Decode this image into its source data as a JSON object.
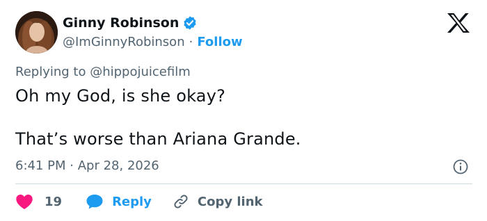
{
  "author": {
    "display_name": "Ginny Robinson",
    "handle": "@ImGinnyRobinson",
    "separator": "·",
    "follow_label": "Follow",
    "verified": true,
    "verified_color": "#1d9bf0"
  },
  "reply_context": {
    "prefix": "Replying to ",
    "mention": "@hippojuicefilm"
  },
  "tweet": {
    "line1": "Oh my God, is she okay?",
    "line2": "That’s worse than Ariana Grande.",
    "time": "6:41 PM",
    "separator": "·",
    "date": "Apr 28, 2026"
  },
  "actions": {
    "like_count": "19",
    "reply_label": "Reply",
    "copy_link_label": "Copy link"
  },
  "icons": [
    "x-logo-icon",
    "verified-badge-icon",
    "info-icon",
    "heart-icon",
    "reply-bubble-icon",
    "link-icon"
  ],
  "colors": {
    "accent": "#1d9bf0",
    "like": "#f91880",
    "text": "#0f1419",
    "secondary": "#536471"
  }
}
